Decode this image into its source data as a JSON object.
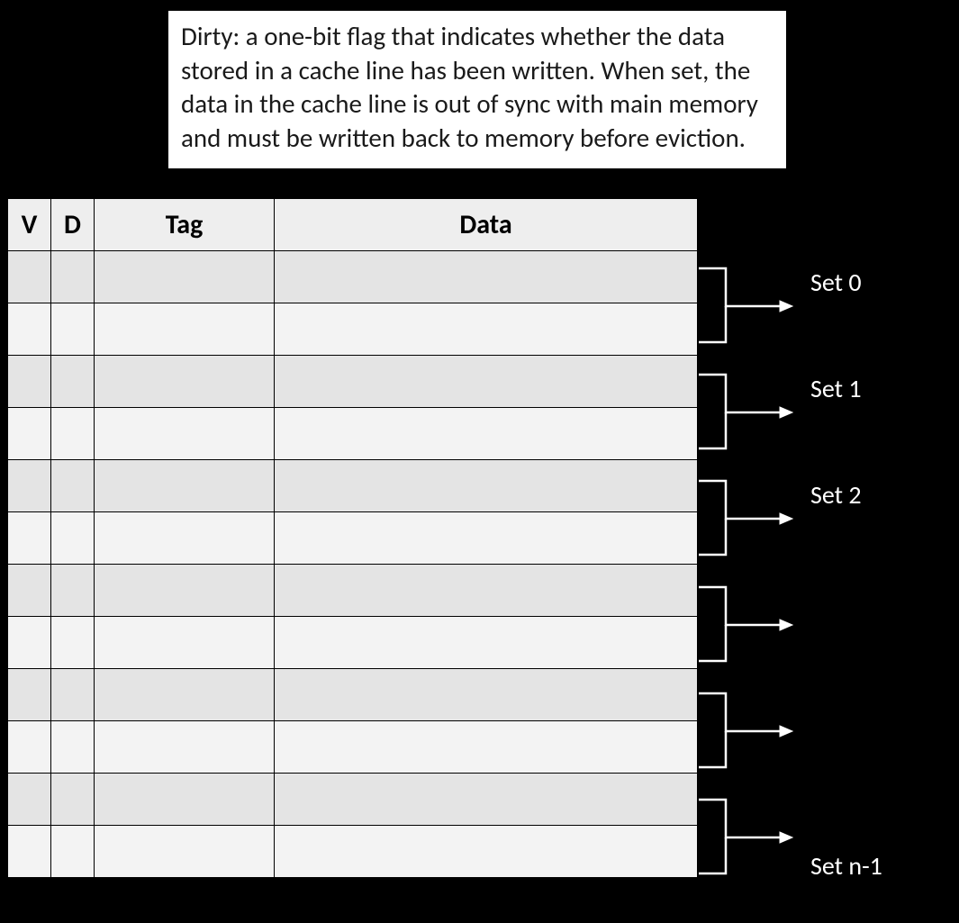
{
  "callout": {
    "text": "Dirty: a one-bit flag that indicates whether the data stored in a cache line has been written.  When set, the data in the cache line is out of sync with main memory and must be written back to memory before eviction."
  },
  "table": {
    "headers": {
      "v": "V",
      "d": "D",
      "tag": "Tag",
      "data": "Data"
    },
    "num_rows": 12
  },
  "sets": [
    {
      "label": "Set 0"
    },
    {
      "label": "Set 1"
    },
    {
      "label": "Set 2"
    },
    {
      "label": ""
    },
    {
      "label": ""
    },
    {
      "label": "Set n-1"
    }
  ]
}
